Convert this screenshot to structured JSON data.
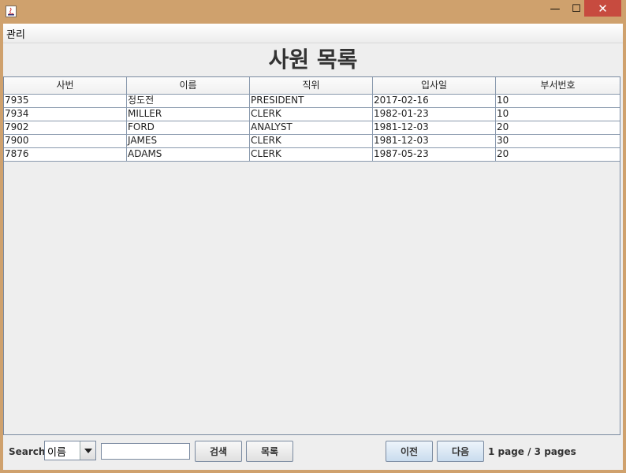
{
  "window": {
    "minimize_glyph": "—",
    "maximize_glyph": "☐",
    "close_glyph": "✕"
  },
  "menu": {
    "items": [
      "관리"
    ]
  },
  "title": "사원 목록",
  "table": {
    "columns": [
      "사번",
      "이름",
      "직위",
      "입사일",
      "부서번호"
    ],
    "rows": [
      [
        "7935",
        "정도전",
        "PRESIDENT",
        "2017-02-16",
        "10"
      ],
      [
        "7934",
        "MILLER",
        "CLERK",
        "1982-01-23",
        "10"
      ],
      [
        "7902",
        "FORD",
        "ANALYST",
        "1981-12-03",
        "20"
      ],
      [
        "7900",
        "JAMES",
        "CLERK",
        "1981-12-03",
        "30"
      ],
      [
        "7876",
        "ADAMS",
        "CLERK",
        "1987-05-23",
        "20"
      ]
    ]
  },
  "search": {
    "label": "Search",
    "field_selected": "이름",
    "input_value": "",
    "search_button": "검색",
    "list_button": "목록"
  },
  "pagination": {
    "prev_button": "이전",
    "next_button": "다음",
    "info": "1 page / 3 pages"
  },
  "colors": {
    "window_frame": "#cfa16d",
    "close_button": "#c74b3f",
    "client_bg": "#eeeeee"
  }
}
